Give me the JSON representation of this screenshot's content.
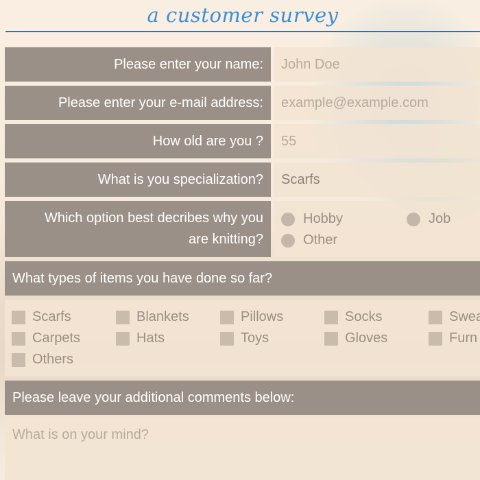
{
  "page": {
    "title": "a customer survey"
  },
  "fields": {
    "name": {
      "label": "Please enter your name:",
      "placeholder": "John Doe"
    },
    "email": {
      "label": "Please enter your e-mail address:",
      "placeholder": "example@example.com"
    },
    "age": {
      "label": "How old are you ?",
      "placeholder": "55"
    },
    "specialization": {
      "label": "What is you specialization?",
      "value": "Scarfs"
    },
    "reason": {
      "label_line1": "Which option best decribes why you",
      "label_line2": "are knitting?",
      "options": [
        "Hobby",
        "Job",
        "Other"
      ]
    }
  },
  "items": {
    "label": "What types of items you have done so far?",
    "options": [
      "Scarfs",
      "Blankets",
      "Pillows",
      "Socks",
      "Swea",
      "Carpets",
      "Hats",
      "Toys",
      "Gloves",
      "Furn",
      "Others"
    ]
  },
  "comments": {
    "label": "Please leave your additional comments below:",
    "placeholder": "What is on your mind?"
  },
  "colors": {
    "title": "#3b8fd3",
    "rule": "#2f6fae",
    "label_bg": "#9b9087",
    "field_bg": "#f3e4d3"
  }
}
